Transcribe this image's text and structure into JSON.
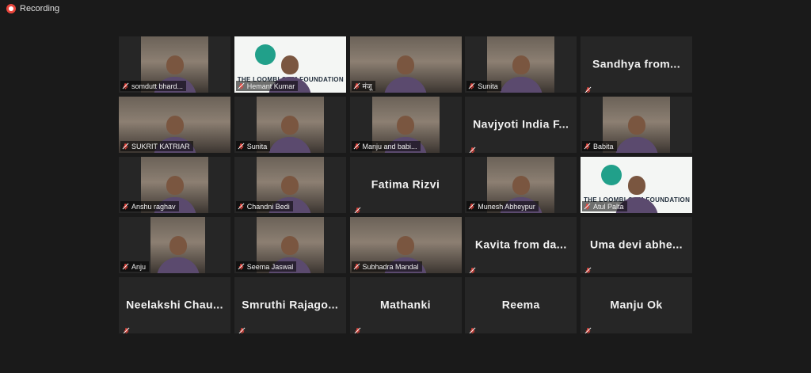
{
  "recording": {
    "label": "Recording"
  },
  "colors": {
    "accent": "#c8e04a",
    "recording": "#e8453c",
    "mute": "#e8453c",
    "background": "#1a1a1a",
    "tile": "#262626"
  },
  "participants": [
    {
      "name": "somdutt bhard...",
      "view": "video"
    },
    {
      "name": "Hemant Kumar",
      "view": "video",
      "backdrop_text": "THE LOOMBLOOM FOUNDATION"
    },
    {
      "name": "मंजू",
      "view": "video"
    },
    {
      "name": "Sunita",
      "view": "video"
    },
    {
      "name": "Sandhya  from...",
      "view": "name"
    },
    {
      "name": "SUKRIT KATRIAR",
      "view": "video"
    },
    {
      "name": "Sunita",
      "view": "video"
    },
    {
      "name": "Manju and babi...",
      "view": "video"
    },
    {
      "name": "Navjyoti  India  F...",
      "view": "name"
    },
    {
      "name": "Babita",
      "view": "video"
    },
    {
      "name": "Anshu raghav",
      "view": "video"
    },
    {
      "name": "Chandni Bedi",
      "view": "video"
    },
    {
      "name": "Fatima  Rizvi",
      "view": "name"
    },
    {
      "name": "Munesh Abheypur",
      "view": "video"
    },
    {
      "name": "Atul Palta",
      "view": "video",
      "backdrop_text": "THE LOOMBLOOM FOUNDATION"
    },
    {
      "name": "Anju",
      "view": "video"
    },
    {
      "name": "Seema Jaswal",
      "view": "video"
    },
    {
      "name": "Subhadra Mandal",
      "view": "video",
      "active_speaker": true
    },
    {
      "name": "Kavita  from  da...",
      "view": "name"
    },
    {
      "name": "Uma  devi  abhe...",
      "view": "name"
    },
    {
      "name": "Neelakshi  Chau...",
      "view": "name"
    },
    {
      "name": "Smruthi  Rajago...",
      "view": "name"
    },
    {
      "name": "Mathanki",
      "view": "name"
    },
    {
      "name": "Reema",
      "view": "name"
    },
    {
      "name": "Manju Ok",
      "view": "name"
    }
  ]
}
